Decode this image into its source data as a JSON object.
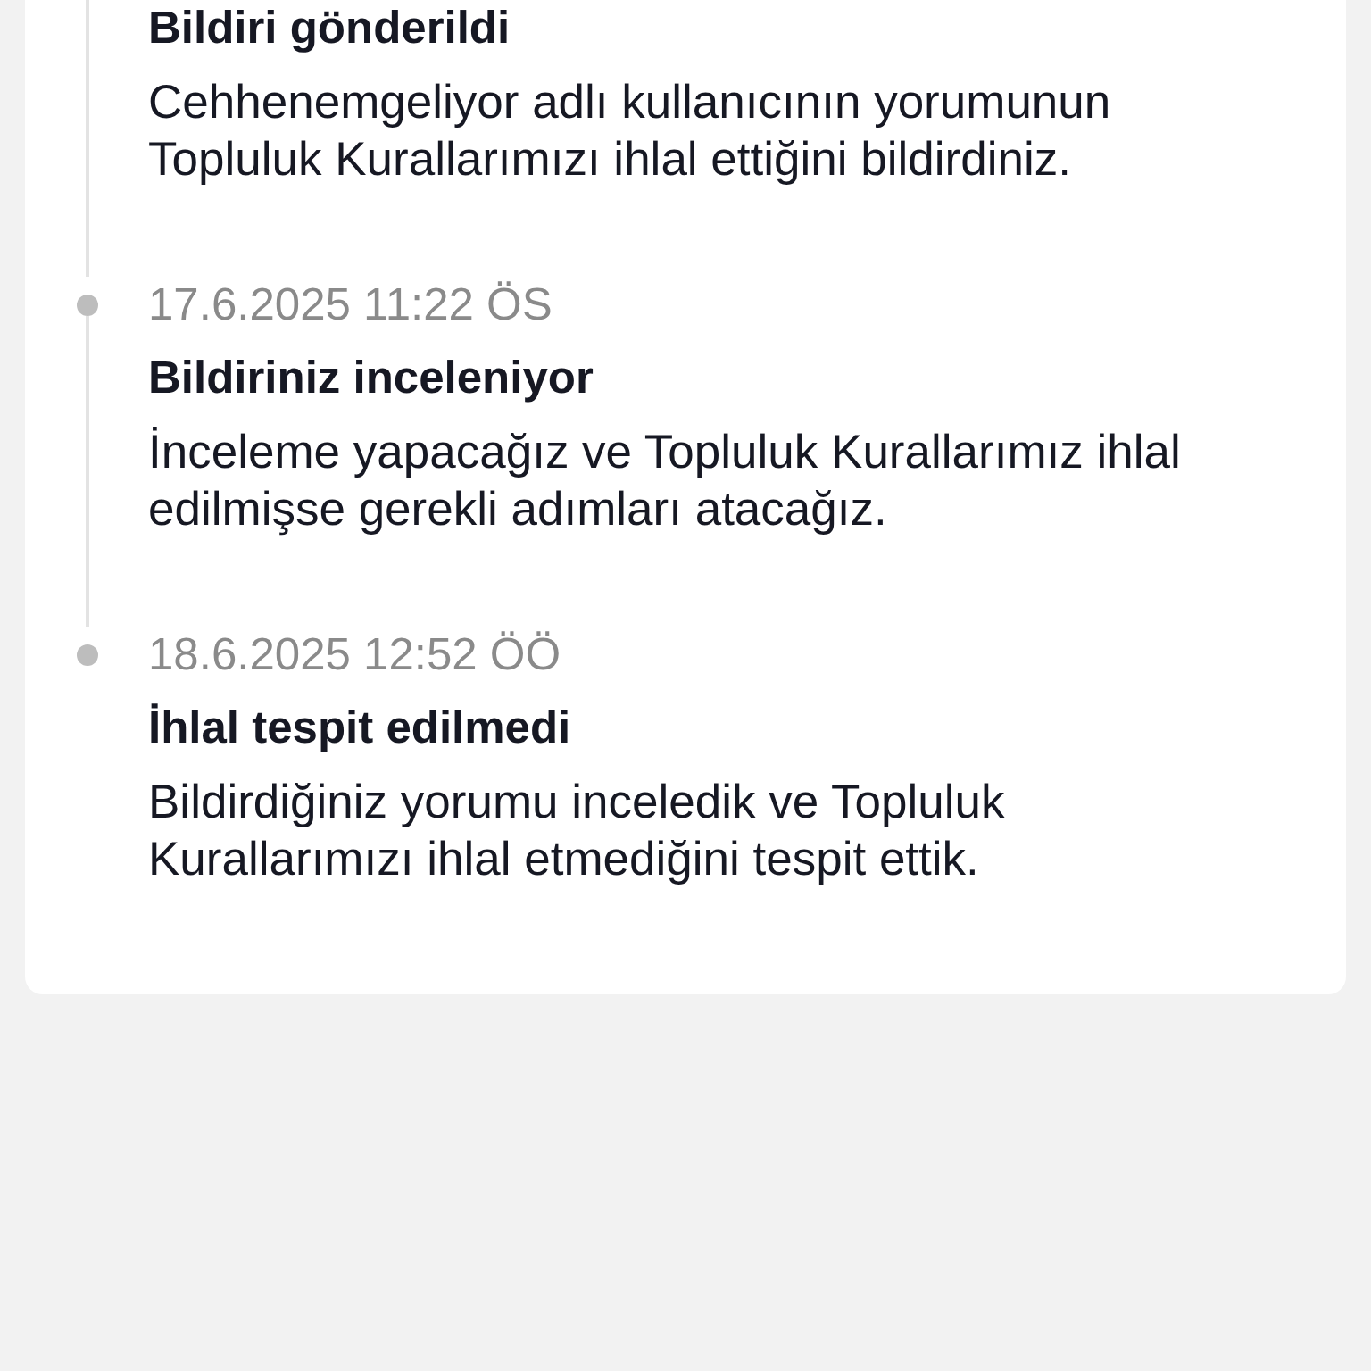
{
  "timeline": [
    {
      "title": "Bildiri gönderildi",
      "body": "Cehhenemgeliyor adlı kullanıcının yorumunun Topluluk Kurallarımızı ihlal ettiğini bildirdiniz."
    },
    {
      "date": "17.6.2025 11:22 ÖS",
      "title": "Bildiriniz inceleniyor",
      "body": "İnceleme yapacağız ve Topluluk Kurallarımız ihlal edilmişse gerekli adımları atacağız."
    },
    {
      "date": "18.6.2025 12:52 ÖÖ",
      "title": "İhlal tespit edilmedi",
      "body": "Bildirdiğiniz yorumu inceledik ve Topluluk Kurallarımızı ihlal etmediğini tespit ettik."
    }
  ]
}
